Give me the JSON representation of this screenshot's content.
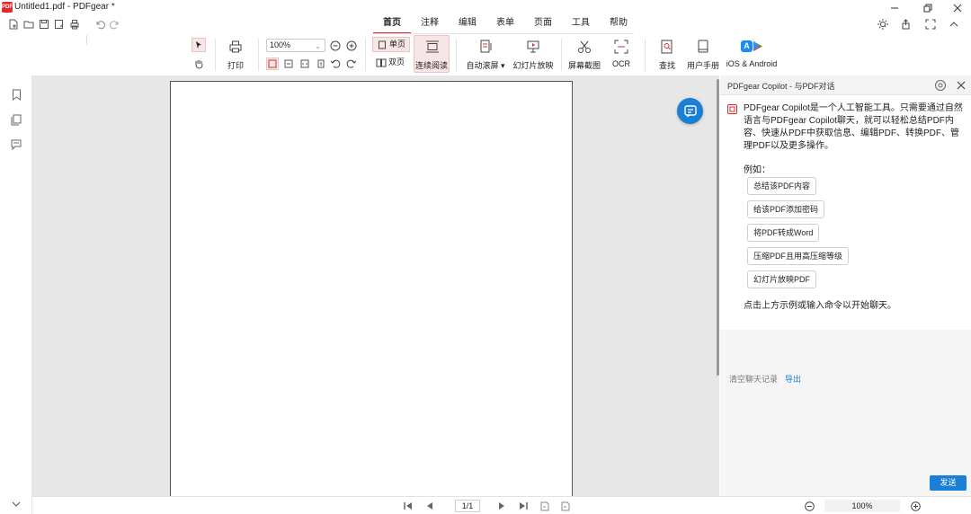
{
  "window": {
    "title": "Untitled1.pdf - PDFgear *",
    "logo_text": "PDF"
  },
  "tabs": [
    {
      "label": "首页",
      "active": true
    },
    {
      "label": "注释"
    },
    {
      "label": "编辑"
    },
    {
      "label": "表单"
    },
    {
      "label": "页面"
    },
    {
      "label": "工具"
    },
    {
      "label": "帮助"
    }
  ],
  "ribbon": {
    "print": "打印",
    "zoom_value": "100%",
    "single_page": "单页",
    "double_page": "双页",
    "continuous": "连续阅读",
    "auto_scroll": "自动滚屏",
    "slideshow": "幻灯片放映",
    "screenshot": "屏幕截图",
    "ocr": "OCR",
    "find": "查找",
    "manual": "用户手册",
    "mobile": "iOS & Android"
  },
  "navigation": {
    "page_indicator": "1/1",
    "zoom": "100%"
  },
  "copilot": {
    "title": "PDFgear Copilot - 与PDF对话",
    "intro": "PDFgear Copilot是一个人工智能工具。只需要通过自然语言与PDFgear Copilot聊天，就可以轻松总结PDF内容、快速从PDF中获取信息、编辑PDF、转换PDF、管理PDF以及更多操作。",
    "examples_label": "例如：",
    "examples": [
      "总结该PDF内容",
      "给该PDF添加密码",
      "将PDF转成Word",
      "压缩PDF且用高压缩等级",
      "幻灯片放映PDF"
    ],
    "hint": "点击上方示例或输入命令以开始聊天。",
    "clear_history": "清空聊天记录",
    "export": "导出",
    "send": "发送"
  },
  "colors": {
    "accent": "#d1242b",
    "primary": "#1b7fd6",
    "doc_bg": "#e7e7e7"
  }
}
